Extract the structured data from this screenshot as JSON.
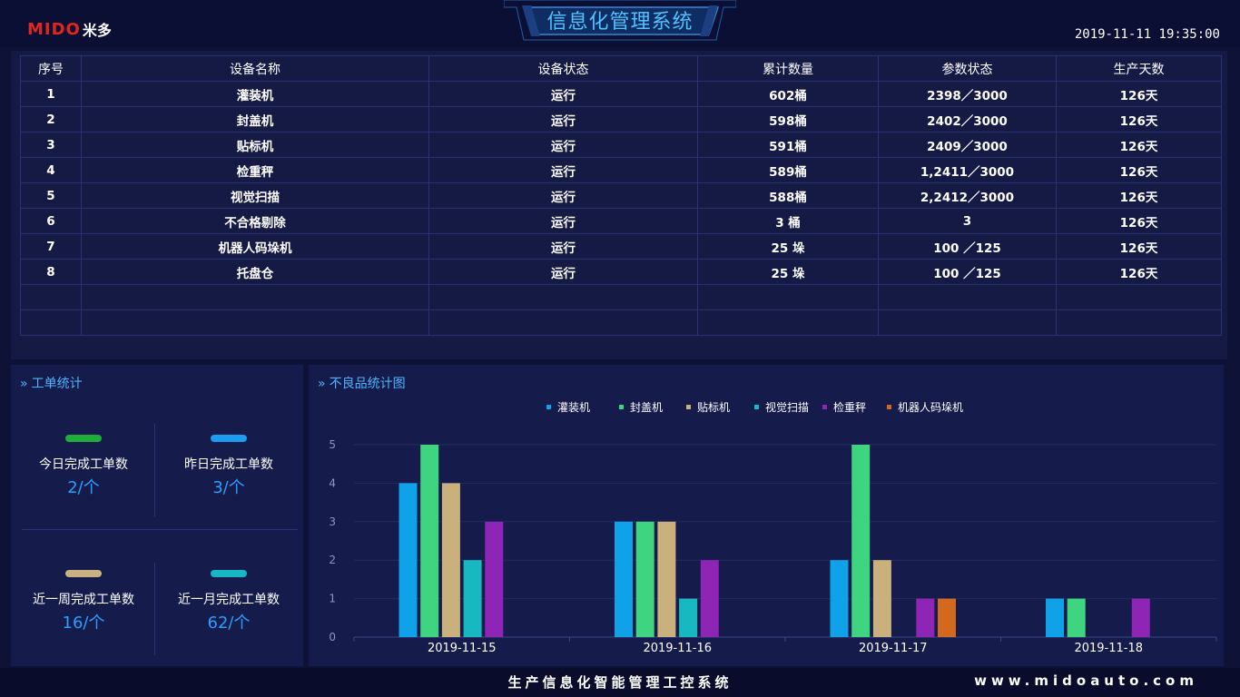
{
  "header": {
    "logo_text": "MIDO",
    "logo_cn": "米多",
    "title": "信息化管理系统",
    "datetime": "2019-11-11  19:35:00"
  },
  "table": {
    "headers": [
      "序号",
      "设备名称",
      "设备状态",
      "累计数量",
      "参数状态",
      "生产天数"
    ],
    "rows": [
      [
        "1",
        "灌装机",
        "运行",
        "602桶",
        "2398／3000",
        "126天"
      ],
      [
        "2",
        "封盖机",
        "运行",
        "598桶",
        "2402／3000",
        "126天"
      ],
      [
        "3",
        "贴标机",
        "运行",
        "591桶",
        "2409／3000",
        "126天"
      ],
      [
        "4",
        "检重秤",
        "运行",
        "589桶",
        "1,2411／3000",
        "126天"
      ],
      [
        "5",
        "视觉扫描",
        "运行",
        "588桶",
        "2,2412／3000",
        "126天"
      ],
      [
        "6",
        "不合格剔除",
        "运行",
        "3 桶",
        "3",
        "126天"
      ],
      [
        "7",
        "机器人码垛机",
        "运行",
        "25 垛",
        "100 ／125",
        "126天"
      ],
      [
        "8",
        "托盘仓",
        "运行",
        "25 垛",
        "100 ／125",
        "126天"
      ]
    ],
    "empty_rows": 2
  },
  "work_orders": {
    "title": "工单统计",
    "stats": [
      {
        "label": "今日完成工单数",
        "value": "2/个",
        "color": "#1fae3a"
      },
      {
        "label": "昨日完成工单数",
        "value": "3/个",
        "color": "#1a9cf0"
      },
      {
        "label": "近一周完成工单数",
        "value": "16/个",
        "color": "#c9b184"
      },
      {
        "label": "近一月完成工单数",
        "value": "62/个",
        "color": "#17b6c7"
      }
    ]
  },
  "defects": {
    "title": "不良品统计图"
  },
  "chart_data": {
    "type": "bar",
    "categories": [
      "2019-11-15",
      "2019-11-16",
      "2019-11-17",
      "2019-11-18"
    ],
    "series": [
      {
        "name": "灌装机",
        "color": "#0fa2e8",
        "values": [
          4,
          3,
          2,
          1
        ]
      },
      {
        "name": "封盖机",
        "color": "#3fd47f",
        "values": [
          5,
          3,
          5,
          1
        ]
      },
      {
        "name": "贴标机",
        "color": "#c9b07c",
        "values": [
          4,
          3,
          2,
          0
        ]
      },
      {
        "name": "视觉扫描",
        "color": "#17b8c0",
        "values": [
          2,
          1,
          0,
          0
        ]
      },
      {
        "name": "检重秤",
        "color": "#8e25b5",
        "values": [
          3,
          2,
          1,
          1
        ]
      },
      {
        "name": "机器人码垛机",
        "color": "#d2691e",
        "values": [
          0,
          0,
          1,
          0
        ]
      }
    ],
    "ylim": [
      0,
      5
    ],
    "yticks": [
      "0",
      "1",
      "2",
      "3",
      "4",
      "5"
    ],
    "legend": "top-center",
    "grid": true
  },
  "footer": {
    "title": "生产信息化智能管理工控系统",
    "url": "www.midoauto.com"
  }
}
